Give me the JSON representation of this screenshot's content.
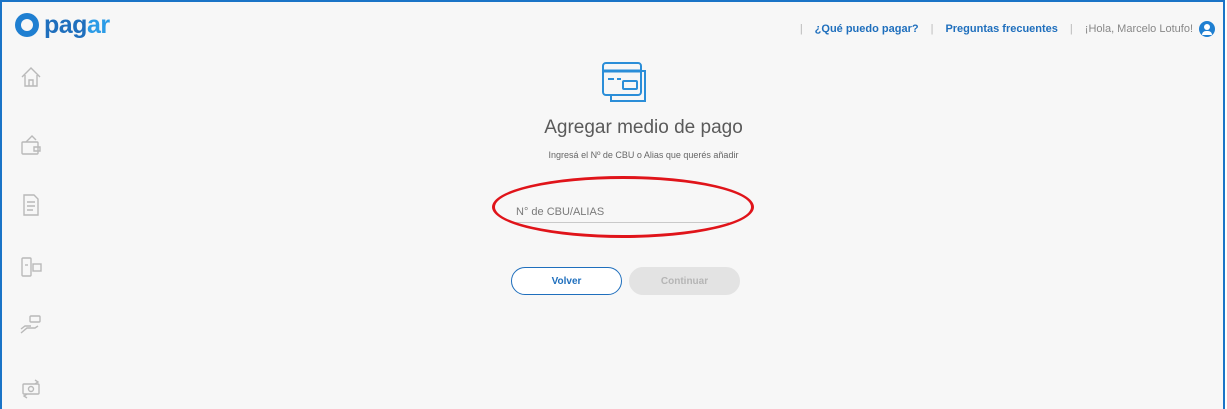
{
  "brand": {
    "logo_main": "pag",
    "logo_light": "ar"
  },
  "topnav": {
    "what_can_i_pay": "¿Qué puedo pagar?",
    "faq": "Preguntas frecuentes",
    "greeting": "¡Hola, Marcelo Lotufo!",
    "separator": "|"
  },
  "sidebar": {
    "items": [
      {
        "icon": "home-icon"
      },
      {
        "icon": "wallet-icon"
      },
      {
        "icon": "document-icon"
      },
      {
        "icon": "mobile-payment-icon"
      },
      {
        "icon": "hand-money-icon"
      },
      {
        "icon": "exchange-icon"
      }
    ]
  },
  "main": {
    "icon": "credit-card-icon",
    "title": "Agregar medio de pago",
    "subtitle": "Ingresá el Nº de CBU o Alias que querés añadir",
    "input_placeholder": "N° de CBU/ALIAS",
    "input_value": "",
    "back_label": "Volver",
    "continue_label": "Continuar"
  },
  "colors": {
    "brand_blue": "#1f6fbd",
    "highlight_red": "#e0141a",
    "background": "#f7f7f7"
  }
}
